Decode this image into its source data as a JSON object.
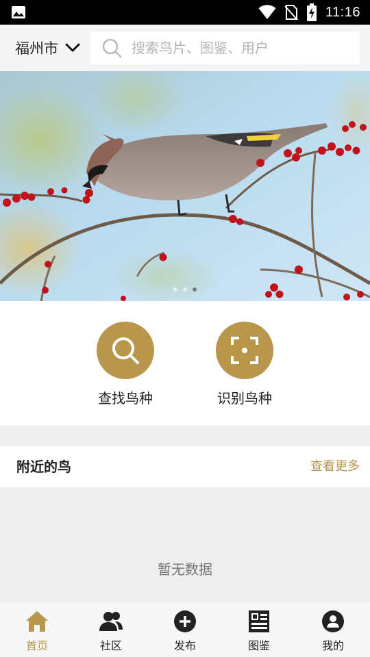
{
  "status_bar": {
    "time": "11:16",
    "icons": [
      "image-icon",
      "wifi-icon",
      "no-sim-icon",
      "battery-charging-icon"
    ]
  },
  "header": {
    "city": "福州市",
    "search_placeholder": "搜索鸟片、图鉴、用户"
  },
  "banner": {
    "slides": 3,
    "active_slide": 3,
    "image": "Bohemian waxwing perched on branch with red berries"
  },
  "actions": [
    {
      "label": "查找鸟种",
      "icon": "search-icon"
    },
    {
      "label": "识别鸟种",
      "icon": "scan-icon"
    }
  ],
  "nearby": {
    "title": "附近的鸟",
    "more": "查看更多",
    "empty": "暂无数据"
  },
  "bottom_nav": [
    {
      "label": "首页",
      "icon": "home-icon",
      "active": true
    },
    {
      "label": "社区",
      "icon": "community-icon",
      "active": false
    },
    {
      "label": "发布",
      "icon": "add-circle-icon",
      "active": false
    },
    {
      "label": "图鉴",
      "icon": "field-guide-icon",
      "active": false
    },
    {
      "label": "我的",
      "icon": "profile-icon",
      "active": false
    }
  ],
  "colors": {
    "accent": "#b8964b",
    "background": "#eeeeee",
    "text": "#222222"
  }
}
